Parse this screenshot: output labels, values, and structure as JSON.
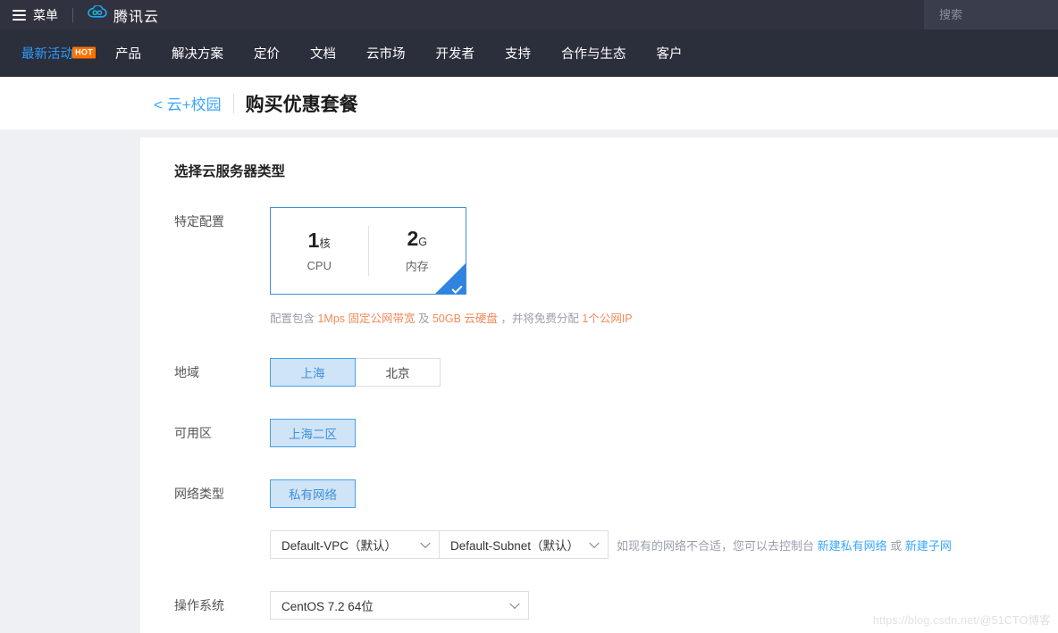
{
  "topbar": {
    "menu_label": "菜单",
    "brand": "腾讯云",
    "search_placeholder": "搜索"
  },
  "nav": {
    "items": [
      {
        "label": "最新活动",
        "badge": "HOT",
        "accent": true
      },
      {
        "label": "产品"
      },
      {
        "label": "解决方案"
      },
      {
        "label": "定价"
      },
      {
        "label": "文档"
      },
      {
        "label": "云市场"
      },
      {
        "label": "开发者"
      },
      {
        "label": "支持"
      },
      {
        "label": "合作与生态"
      },
      {
        "label": "客户"
      }
    ]
  },
  "header": {
    "back_label": "< 云+校园",
    "title": "购买优惠套餐"
  },
  "main": {
    "section_title": "选择云服务器类型",
    "spec": {
      "label": "特定配置",
      "cpu_num": "1",
      "cpu_unit": "核",
      "cpu_sub": "CPU",
      "mem_num": "2",
      "mem_unit": "G",
      "mem_sub": "内存",
      "note_parts": [
        {
          "t": "配置包含 ",
          "hi": false
        },
        {
          "t": "1Mps 固定公网带宽",
          "hi": true
        },
        {
          "t": " 及 ",
          "hi": false
        },
        {
          "t": "50GB 云硬盘",
          "hi": true
        },
        {
          "t": " ，并将免费分配 ",
          "hi": false
        },
        {
          "t": "1个公网IP",
          "hi": true
        }
      ]
    },
    "region": {
      "label": "地域",
      "options": [
        {
          "label": "上海",
          "selected": true
        },
        {
          "label": "北京",
          "selected": false
        }
      ]
    },
    "zone": {
      "label": "可用区",
      "options": [
        {
          "label": "上海二区",
          "selected": true
        }
      ]
    },
    "network": {
      "label": "网络类型",
      "options": [
        {
          "label": "私有网络",
          "selected": true
        }
      ],
      "vpc_value": "Default-VPC（默认）",
      "subnet_value": "Default-Subnet（默认）",
      "hint_prefix": "如现有的网络不合适，您可以去控制台 ",
      "hint_link1": "新建私有网络",
      "hint_mid": " 或 ",
      "hint_link2": "新建子网"
    },
    "os": {
      "label": "操作系统",
      "value": "CentOS 7.2 64位"
    }
  },
  "watermark": {
    "url": "https://blog.csdn.net/",
    "tag": "@51CTO博客"
  }
}
